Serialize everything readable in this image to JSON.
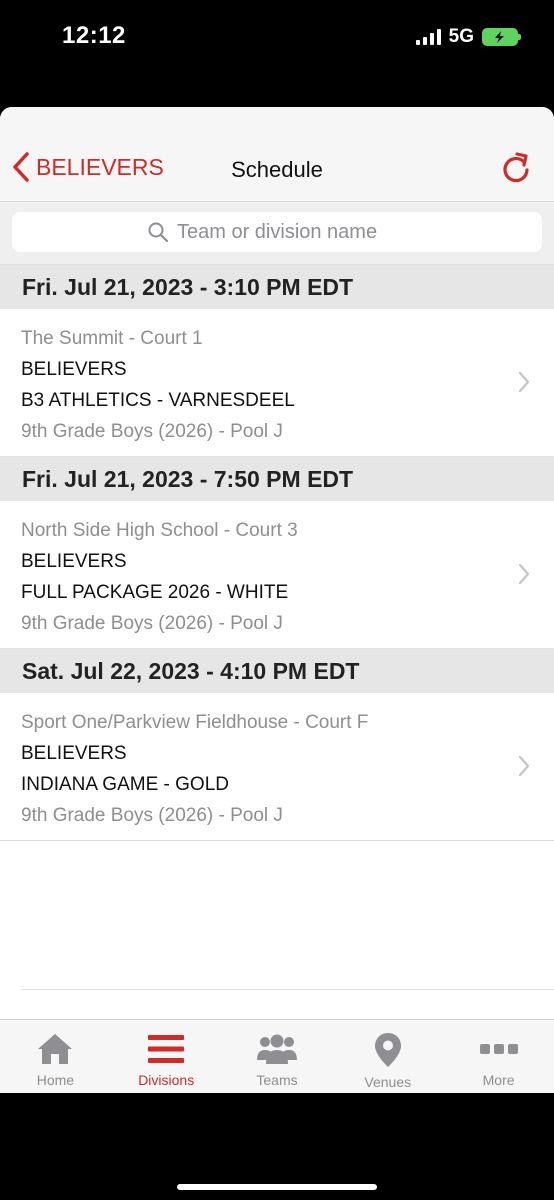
{
  "status_bar": {
    "time": "12:12",
    "network": "5G"
  },
  "nav": {
    "back_label": "BELIEVERS",
    "title": "Schedule"
  },
  "search": {
    "placeholder": "Team or division name",
    "value": ""
  },
  "schedule": [
    {
      "date": "Fri. Jul 21, 2023 - 3:10 PM EDT",
      "venue": "The Summit - Court 1",
      "team1": "BELIEVERS",
      "team2": "B3 ATHLETICS - VARNESDEEL",
      "division": "9th Grade Boys (2026) - Pool J"
    },
    {
      "date": "Fri. Jul 21, 2023 - 7:50 PM EDT",
      "venue": "North Side High School - Court 3",
      "team1": "BELIEVERS",
      "team2": "FULL PACKAGE 2026 - WHITE",
      "division": "9th Grade Boys (2026) - Pool J"
    },
    {
      "date": "Sat. Jul 22, 2023 - 4:10 PM EDT",
      "venue": "Sport One/Parkview Fieldhouse - Court F",
      "team1": "BELIEVERS",
      "team2": "INDIANA GAME - GOLD",
      "division": "9th Grade Boys (2026) - Pool J"
    }
  ],
  "tabs": [
    {
      "label": "Home",
      "icon": "home-icon",
      "active": false
    },
    {
      "label": "Divisions",
      "icon": "divisions-icon",
      "active": true
    },
    {
      "label": "Teams",
      "icon": "teams-icon",
      "active": false
    },
    {
      "label": "Venues",
      "icon": "venues-icon",
      "active": false
    },
    {
      "label": "More",
      "icon": "more-icon",
      "active": false
    }
  ],
  "colors": {
    "accent": "#cf2b27",
    "inactive": "#8e8e93",
    "header_bg": "#e6e6e6",
    "battery": "#5fd35f"
  }
}
